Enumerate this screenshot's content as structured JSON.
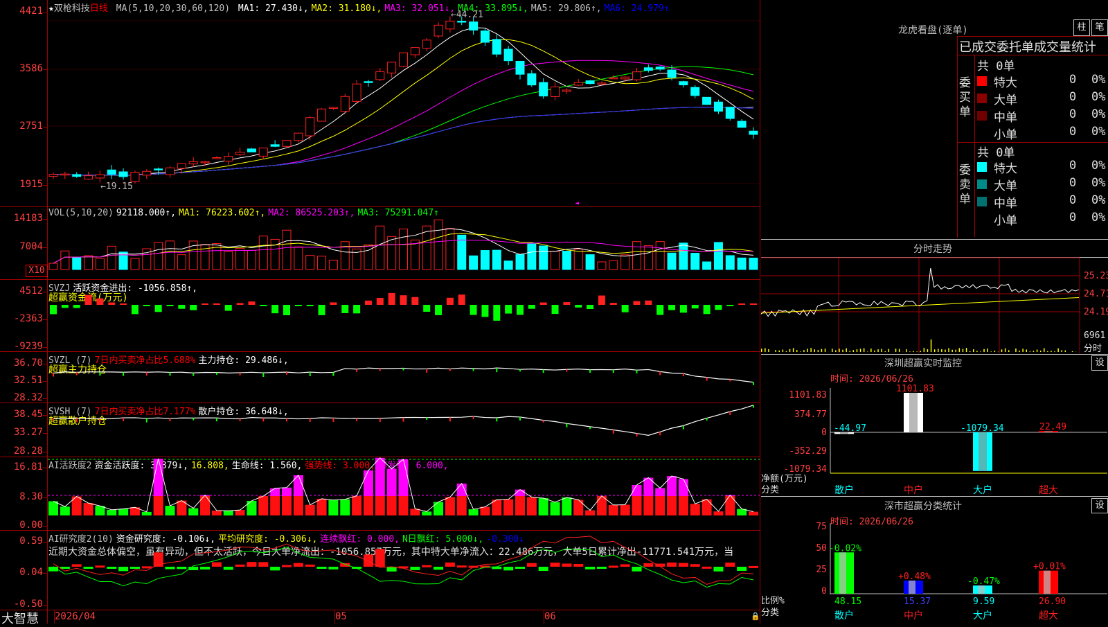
{
  "main_chart": {
    "star": "★",
    "stock_name": "双枪科技",
    "period": "日线",
    "ma_params": "MA(5,10,20,30,60,120)",
    "ma_values": [
      {
        "label": "MA1: 27.430↓,",
        "color": "#ffffff"
      },
      {
        "label": "MA2: 31.180↓,",
        "color": "#ffff00"
      },
      {
        "label": "MA3: 32.051↓,",
        "color": "#ff00ff"
      },
      {
        "label": "MA4: 33.895↓,",
        "color": "#00ff00"
      },
      {
        "label": "MA5: 29.806↑,",
        "color": "#c0c0c0"
      },
      {
        "label": "MA6: 24.979↑",
        "color": "#0000ff"
      }
    ],
    "y_ticks": [
      "4421",
      "3586",
      "2751",
      "1915"
    ],
    "max_label": "44.21",
    "min_label": "19.15",
    "grid_y": [
      30,
      100,
      182,
      265
    ]
  },
  "volume": {
    "legend": [
      {
        "label": "VOL(5,10,20)",
        "color": "#c0c0c0"
      },
      {
        "label": "92118.000↑,",
        "color": "#ffffff"
      },
      {
        "label": "MA1: 76223.602↑,",
        "color": "#ffff00"
      },
      {
        "label": "MA2: 86525.203↑,",
        "color": "#ff00ff"
      },
      {
        "label": "MA3: 75291.047↑",
        "color": "#00ff00"
      }
    ],
    "y_ticks": [
      "14183",
      "7004"
    ],
    "unit": "X10"
  },
  "svzj": {
    "line1": [
      {
        "label": "SVZJ",
        "color": "#c0c0c0"
      },
      {
        "label": "活跃资金进出: -1056.858↑,",
        "color": "#ffffff"
      }
    ],
    "line2": "超赢资金流(万元)",
    "y_ticks": [
      "4512",
      "-2363",
      "-9239"
    ]
  },
  "svzl": {
    "line1": [
      {
        "label": "SVZL (7)",
        "color": "#c0c0c0"
      },
      {
        "label": "7日内买卖净占比5.688%",
        "color": "#ff0000"
      },
      {
        "label": "主力持仓: 29.486↓,",
        "color": "#ffffff"
      }
    ],
    "line2": "超赢主力持仓",
    "y_ticks": [
      "36.70",
      "32.51",
      "28.32"
    ]
  },
  "svsh": {
    "line1": [
      {
        "label": "SVSH (7)",
        "color": "#c0c0c0"
      },
      {
        "label": "7日内买卖净占比7.177%",
        "color": "#ff0000"
      },
      {
        "label": "散户持仓: 36.648↓,",
        "color": "#ffffff"
      }
    ],
    "line2": "超赢散户持仓",
    "y_ticks": [
      "38.45",
      "33.27",
      "28.28"
    ]
  },
  "ai_active": {
    "line1": [
      {
        "label": "AI活跃度2",
        "color": "#c0c0c0"
      },
      {
        "label": "资金活跃度: 3.879↓,",
        "color": "#ffffff"
      },
      {
        "label": "16.808,",
        "color": "#ffff00"
      },
      {
        "label": "生命线: 1.560,",
        "color": "#ffffff"
      },
      {
        "label": "强势线: 3.000,",
        "color": "#ff0000"
      },
      {
        "label": "爆发线: 6.000,",
        "color": "#ff00ff"
      }
    ],
    "y_ticks": [
      "16.81",
      "8.30",
      "0.00"
    ]
  },
  "ai_research": {
    "line1": [
      {
        "label": "AI研究度2(10)",
        "color": "#c0c0c0"
      },
      {
        "label": "资金研究度: -0.106↓,",
        "color": "#ffffff"
      },
      {
        "label": "平均研究度: -0.306↓,",
        "color": "#ffff00"
      },
      {
        "label": "连续飘红: 0.000,",
        "color": "#ff00ff"
      },
      {
        "label": "N日飘红: 5.000↓,",
        "color": "#00ff00"
      },
      {
        "label": "-0.300↓",
        "color": "#0000ff"
      }
    ],
    "line2": "近期大资金总体偏空，虽有异动，但不太活跃，今日大单净流出：-1056.857万元，其中特大单净流入：22.486万元，大单5日累计净出-11771.541万元，当",
    "y_ticks": [
      "0.59",
      "0.04",
      "-0.50"
    ]
  },
  "bottom_bar": {
    "brand": "大智慧",
    "dates": [
      "2026/04",
      "05",
      "06"
    ]
  },
  "right_panel": {
    "lhb_title": "龙虎看盘(逐单)",
    "btn_zhu": "柱",
    "btn_bi": "笔",
    "stats_title": "已成交委托单成交量统计",
    "buy_label": "委买单",
    "sell_label": "委卖单",
    "buy_total": "共 0单",
    "sell_total": "共 0单",
    "buy_rows": [
      {
        "name": "特大",
        "count": "0",
        "pct": "0%",
        "color": "#ff0000"
      },
      {
        "name": "大单",
        "count": "0",
        "pct": "0%",
        "color": "#8b0000"
      },
      {
        "name": "中单",
        "count": "0",
        "pct": "0%",
        "color": "#700000"
      },
      {
        "name": "小单",
        "count": "0",
        "pct": "0%",
        "color": "#000000"
      }
    ],
    "sell_rows": [
      {
        "name": "特大",
        "count": "0",
        "pct": "0%",
        "color": "#00ffff"
      },
      {
        "name": "大单",
        "count": "0",
        "pct": "0%",
        "color": "#008b8b"
      },
      {
        "name": "中单",
        "count": "0",
        "pct": "0%",
        "color": "#007070"
      },
      {
        "name": "小单",
        "count": "0",
        "pct": "0%",
        "color": "#000000"
      }
    ],
    "fenshi_title": "分时走势",
    "fenshi_ticks": [
      "25.23",
      "24.71",
      "24.19"
    ],
    "fenshi_vol": "6961",
    "fenshi_unit": "分时",
    "monitor_title": "深圳超赢实时监控",
    "set_label": "设",
    "time_label": "时间: 2026/06/26",
    "monitor_ticks": [
      "1101.83",
      "374.77",
      "0",
      "-352.29",
      "-1079.34"
    ],
    "monitor_values": [
      {
        "name": "散户",
        "label": "-44.97",
        "value": -44.97,
        "color": "#ffffff"
      },
      {
        "name": "中户",
        "label": "1101.83",
        "value": 1101.83,
        "color": "#ffffff"
      },
      {
        "name": "大户",
        "label": "-1079.34",
        "value": -1079.34,
        "color": "#00ffff"
      },
      {
        "name": "超大",
        "label": "22.49",
        "value": 22.49,
        "color": "#ff0000"
      }
    ],
    "monitor_ylabel": "净额(万元)",
    "classify_label": "分类",
    "stat_title": "深市超赢分类统计",
    "stat_ticks": [
      "75",
      "50",
      "25",
      "0"
    ],
    "stat_values": [
      {
        "name": "散户",
        "pct": "48.15",
        "change": "-0.02%",
        "value": 48.15,
        "color": "#00ff00"
      },
      {
        "name": "中户",
        "pct": "15.37",
        "change": "+0.48%",
        "value": 15.37,
        "color": "#0000ff"
      },
      {
        "name": "大户",
        "pct": "9.59",
        "change": "-0.47%",
        "value": 9.59,
        "color": "#00ffff"
      },
      {
        "name": "超大",
        "pct": "26.90",
        "change": "+0.01%",
        "value": 26.9,
        "color": "#ff0000"
      }
    ],
    "stat_ylabel": "比例%"
  }
}
